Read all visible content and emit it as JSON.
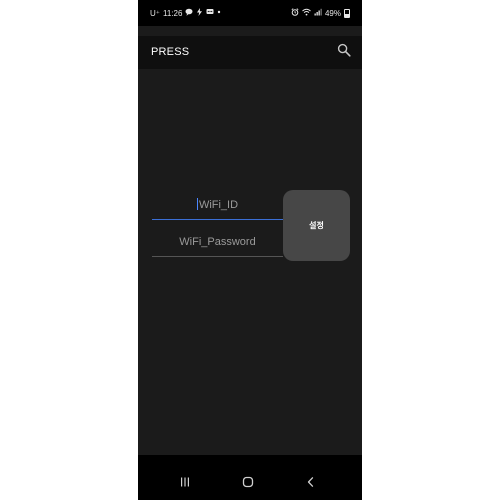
{
  "status_bar": {
    "carrier": "U⁺",
    "time": "11:26",
    "battery": "49%",
    "notification_icons": [
      "chat-icon",
      "lightning-icon",
      "message-icon",
      "dot-icon"
    ],
    "system_icons": [
      "alarm-icon",
      "wifi-icon",
      "signal-icon",
      "battery-icon"
    ]
  },
  "app_bar": {
    "title": "PRESS",
    "search_icon": "search-icon"
  },
  "form": {
    "wifi_id_placeholder": "WiFi_ID",
    "wifi_password_placeholder": "WiFi_Password",
    "setting_button_label": "설정"
  },
  "nav_bar": {
    "buttons": [
      "recents-icon",
      "home-icon",
      "back-icon"
    ]
  },
  "colors": {
    "focus_accent": "#3b6fd6",
    "background": "#1b1b1b",
    "button": "#474747"
  }
}
